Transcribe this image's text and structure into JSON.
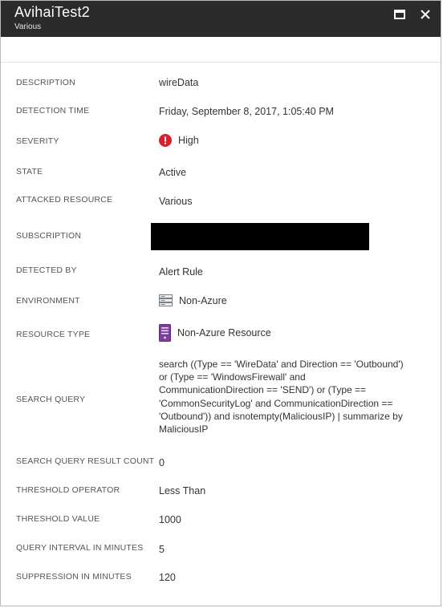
{
  "window": {
    "title": "AvihaiTest2",
    "subtitle": "Various"
  },
  "icons": {
    "maximize": "maximize-icon",
    "close": "close-icon",
    "severity": "error-circle-icon",
    "environment": "server-icon",
    "resource_type": "server-tower-icon"
  },
  "colors": {
    "titlebar": "#2b2b2b",
    "severity_high": "#d9202e",
    "resource_icon": "#7b3f9e"
  },
  "details": {
    "description": {
      "label": "DESCRIPTION",
      "value": "wireData"
    },
    "detection_time": {
      "label": "DETECTION TIME",
      "value": "Friday, September 8, 2017, 1:05:40 PM"
    },
    "severity": {
      "label": "SEVERITY",
      "value": "High"
    },
    "state": {
      "label": "STATE",
      "value": "Active"
    },
    "attacked_resource": {
      "label": "ATTACKED RESOURCE",
      "value": "Various"
    },
    "subscription": {
      "label": "SUBSCRIPTION"
    },
    "detected_by": {
      "label": "DETECTED BY",
      "value": "Alert Rule"
    },
    "environment": {
      "label": "ENVIRONMENT",
      "value": "Non-Azure"
    },
    "resource_type": {
      "label": "RESOURCE TYPE",
      "value": "Non-Azure Resource"
    },
    "search_query": {
      "label": "SEARCH QUERY",
      "value": "search ((Type == 'WireData' and Direction == 'Outbound') or (Type == 'WindowsFirewall' and CommunicationDirection == 'SEND') or (Type == 'CommonSecurityLog' and CommunicationDirection == 'Outbound')) and isnotempty(MaliciousIP) | summarize by MaliciousIP"
    },
    "search_query_result_count": {
      "label": "SEARCH QUERY RESULT COUNT",
      "value": "0"
    },
    "threshold_operator": {
      "label": "THRESHOLD OPERATOR",
      "value": "Less Than"
    },
    "threshold_value": {
      "label": "THRESHOLD VALUE",
      "value": "1000"
    },
    "query_interval": {
      "label": "QUERY INTERVAL IN MINUTES",
      "value": "5"
    },
    "suppression": {
      "label": "SUPPRESSION IN MINUTES",
      "value": "120"
    }
  }
}
